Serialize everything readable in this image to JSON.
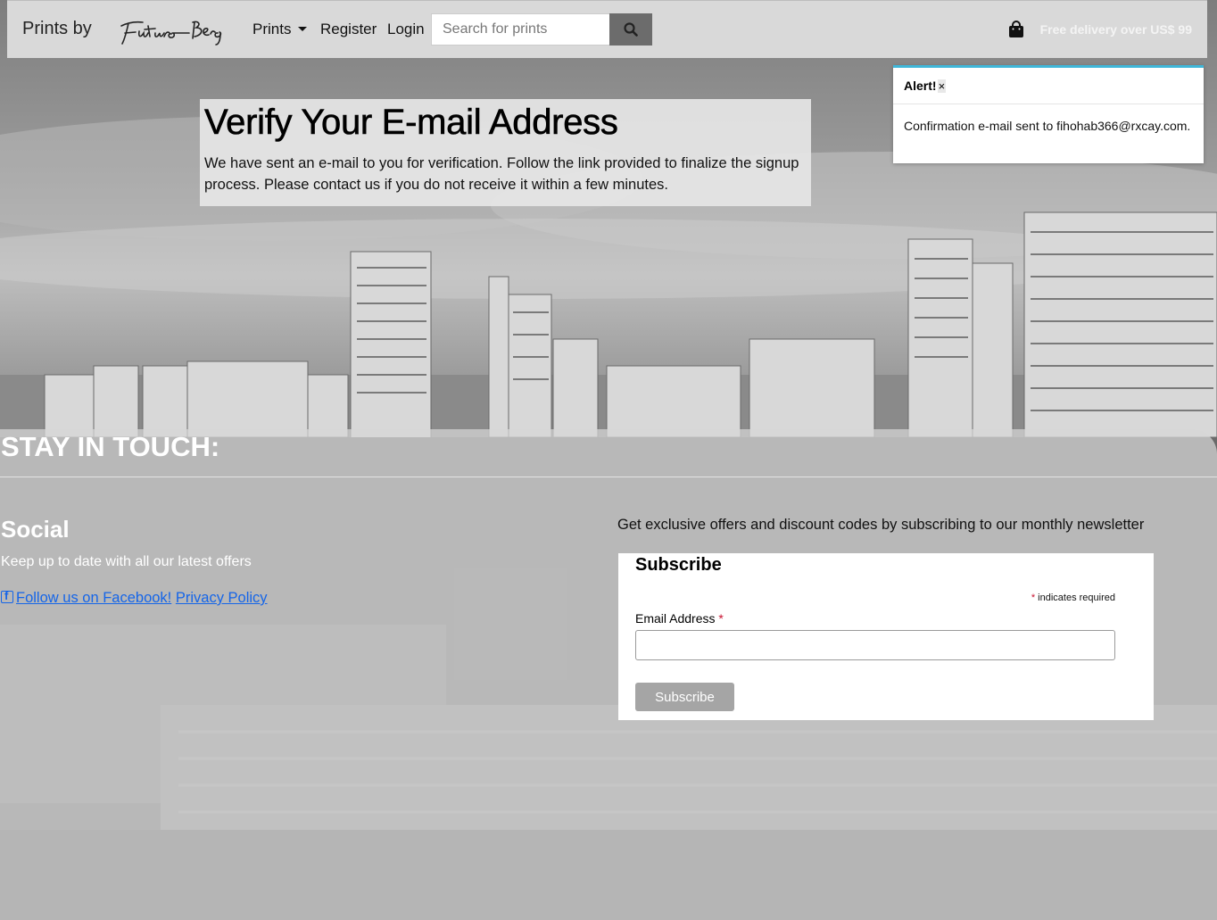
{
  "navbar": {
    "brand_text": "Prints by",
    "brand_logo": "Futuro Berg",
    "prints_label": "Prints",
    "register_label": "Register",
    "login_label": "Login",
    "search_placeholder": "Search for prints",
    "search_icon": "magnifier-icon",
    "bag_icon": "shopping-bag-icon",
    "delivery_text": "Free delivery over US$ 99"
  },
  "verify": {
    "title": "Verify Your E-mail Address",
    "message": "We have sent an e-mail to you for verification. Follow the link provided to finalize the signup process. Please contact us if you do not receive it within a few minutes."
  },
  "toast": {
    "title": "Alert!",
    "close": "×",
    "body": "Confirmation e-mail sent to fihohab366@rxcay.com.",
    "accent_color": "#3fb6d8"
  },
  "footer": {
    "stay_in_touch": "STAY IN TOUCH:",
    "social_heading": "Social",
    "social_text": "Keep up to date with all our latest offers",
    "facebook_link": "Follow us on Facebook!",
    "privacy_link": "Privacy Policy",
    "link_color": "#1565e8",
    "newsletter_text": "Get exclusive offers and discount codes by subscribing to our monthly newsletter"
  },
  "subscribe": {
    "title": "Subscribe",
    "asterisk": "*",
    "required_note": "indicates required",
    "email_label": "Email Address",
    "button_label": "Subscribe"
  }
}
